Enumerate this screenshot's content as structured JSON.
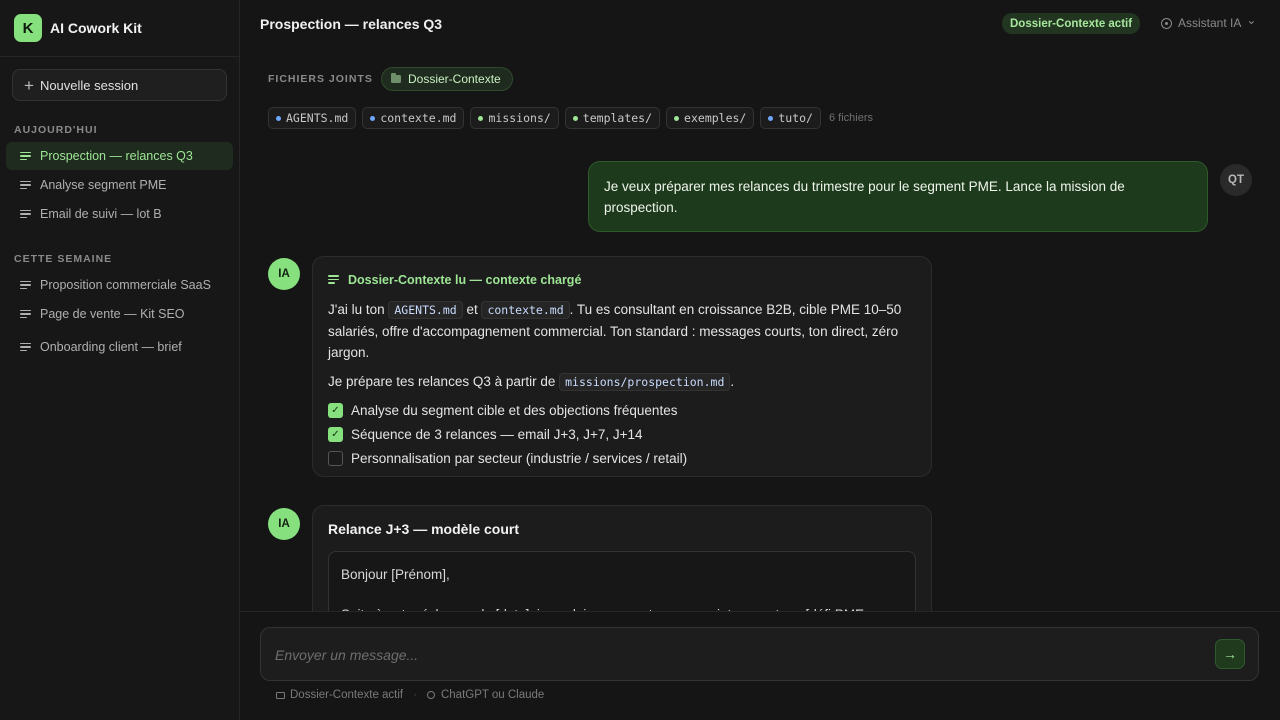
{
  "app": {
    "logo_letter": "K",
    "name": "AI Cowork Kit"
  },
  "sidebar": {
    "new_session_label": "Nouvelle session",
    "sections": [
      {
        "label": "AUJOURD'HUI",
        "items": [
          "Prospection — relances Q3",
          "Analyse segment PME",
          "Email de suivi — lot B"
        ]
      },
      {
        "label": "CETTE SEMAINE",
        "items": [
          "Proposition commerciale SaaS",
          "Page de vente — Kit SEO",
          "Onboarding client — brief"
        ]
      }
    ],
    "active_item": "Prospection — relances Q3"
  },
  "header": {
    "title": "Prospection — relances Q3",
    "status_badge": "Dossier-Contexte actif",
    "assistant_label": "Assistant IA",
    "assistant_chevron": "⌄"
  },
  "attachments": {
    "label": "FICHIERS JOINTS",
    "folder": "Dossier-Contexte",
    "files": [
      {
        "name": "AGENTS.md",
        "color": "#6ea8ff"
      },
      {
        "name": "contexte.md",
        "color": "#6ea8ff"
      },
      {
        "name": "missions/",
        "color": "#9ee596"
      },
      {
        "name": "templates/",
        "color": "#9ee596"
      },
      {
        "name": "exemples/",
        "color": "#9ee596"
      },
      {
        "name": "tuto/",
        "color": "#6ea8ff"
      }
    ],
    "count": "6 fichiers"
  },
  "messages": {
    "user": {
      "avatar": "QT",
      "text": "Je veux préparer mes relances du trimestre pour le segment PME. Lance la mission de prospection."
    },
    "ai1": {
      "avatar": "IA",
      "header": "Dossier-Contexte lu — contexte chargé",
      "p1_before": "J'ai lu ton ",
      "p1_code1": "AGENTS.md",
      "p1_mid": " et ",
      "p1_code2": "contexte.md",
      "p1_after": ". Tu es consultant en croissance B2B, cible PME 10–50 salariés, offre d'accompagnement commercial. Ton standard : messages courts, ton direct, zéro jargon.",
      "p2_before": "Je prépare tes relances Q3 à partir de ",
      "p2_code": "missions/prospection.md",
      "p2_after": ".",
      "checklist": [
        {
          "label": "Analyse du segment cible et des objections fréquentes",
          "checked": true
        },
        {
          "label": "Séquence de 3 relances — email J+3, J+7, J+14",
          "checked": true
        },
        {
          "label": "Personnalisation par secteur (industrie / services / retail)",
          "checked": false
        }
      ]
    },
    "ai2": {
      "avatar": "IA",
      "title": "Relance J+3 — modèle court",
      "line1": "Bonjour [Prénom],",
      "line2": "Suite à notre échange du [date], je voulais vous partager un point concret sur [défi PME"
    }
  },
  "composer": {
    "placeholder": "Envoyer un message...",
    "send_icon": "→",
    "hint_context": "Dossier-Contexte actif",
    "hint_separator": "·",
    "hint_model": "ChatGPT ou Claude"
  },
  "colors": {
    "accent": "#86e07e",
    "accent_text": "#9ee596",
    "user_bubble": "#1e3a1c",
    "background": "#151515"
  }
}
